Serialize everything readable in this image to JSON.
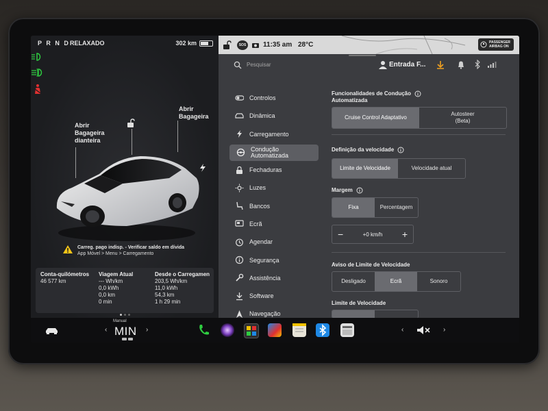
{
  "left_panel": {
    "gears": "P R N D",
    "gear_separator": "·",
    "drive_mode": "RELAXADO",
    "range": "302 km",
    "battery_level": 0.7,
    "trunk_front_label": "Abrir\nBagageira\ndianteira",
    "trunk_rear_label": "Abrir\nBagageira",
    "warning_line1": "Carreg. pago indisp. - Verificar saldo em dívida",
    "warning_line2": "App Móvel > Menu > Carregamento",
    "stats": {
      "odometer_title": "Conta-quilómetros",
      "odometer_value": "46 577 km",
      "trip_title": "Viagem Atual",
      "trip_values": [
        "--- Wh/km",
        "0,0 kWh",
        "0,0 km",
        "0 min"
      ],
      "since_charge_title": "Desde o Carregamen",
      "since_charge_values": [
        "203,5 Wh/km",
        "11,0 kWh",
        "54,3 km",
        "1 h 29 min"
      ]
    }
  },
  "status_bar": {
    "time": "11:35 am",
    "temperature": "28°C",
    "sos": "SOS",
    "airbag_line1": "PASSENGER",
    "airbag_line2": "AIRBAG ON"
  },
  "search": {
    "placeholder": "Pesquisar",
    "user": "Entrada F..."
  },
  "sidebar": {
    "items": [
      {
        "label": "Controlos",
        "icon": "toggle-icon"
      },
      {
        "label": "Dinâmica",
        "icon": "car-icon"
      },
      {
        "label": "Carregamento",
        "icon": "bolt-icon"
      },
      {
        "label": "Condução\nAutomatizada",
        "icon": "steering-wheel-icon",
        "selected": true
      },
      {
        "label": "Fechaduras",
        "icon": "lock-icon"
      },
      {
        "label": "Luzes",
        "icon": "sun-icon"
      },
      {
        "label": "Bancos",
        "icon": "seat-icon"
      },
      {
        "label": "Ecrã",
        "icon": "screen-icon"
      },
      {
        "label": "Agendar",
        "icon": "clock-icon"
      },
      {
        "label": "Segurança",
        "icon": "info-icon"
      },
      {
        "label": "Assistência",
        "icon": "wrench-icon"
      },
      {
        "label": "Software",
        "icon": "download-icon"
      },
      {
        "label": "Navegação",
        "icon": "navigation-icon"
      }
    ]
  },
  "content": {
    "features_title": "Funcionalidades de Condução\nAutomatizada",
    "features_options": [
      "Cruise Control Adaptativo",
      "Autosteer\n(Beta)"
    ],
    "features_selected": 0,
    "speed_def_title": "Definição da velocidade",
    "speed_def_options": [
      "Limite de Velocidade",
      "Velocidade atual"
    ],
    "speed_def_selected": 0,
    "margin_title": "Margem",
    "margin_options": [
      "Fixa",
      "Percentagem"
    ],
    "margin_selected": 0,
    "offset_value": "+0 km/h",
    "minus": "−",
    "plus": "+",
    "limit_warning_title": "Aviso de Limite de Velocidade",
    "limit_warning_options": [
      "Desligado",
      "Ecrã",
      "Sonoro"
    ],
    "limit_warning_selected": 1,
    "speed_limit_title": "Limite de Velocidade"
  },
  "dock": {
    "climate_mode": "Manual",
    "climate_value": "MIN",
    "volume_state": "mute"
  },
  "colors": {
    "accent_green": "#2ecc40",
    "warning_red": "#e03030",
    "bluetooth_blue": "#1e88e5"
  }
}
